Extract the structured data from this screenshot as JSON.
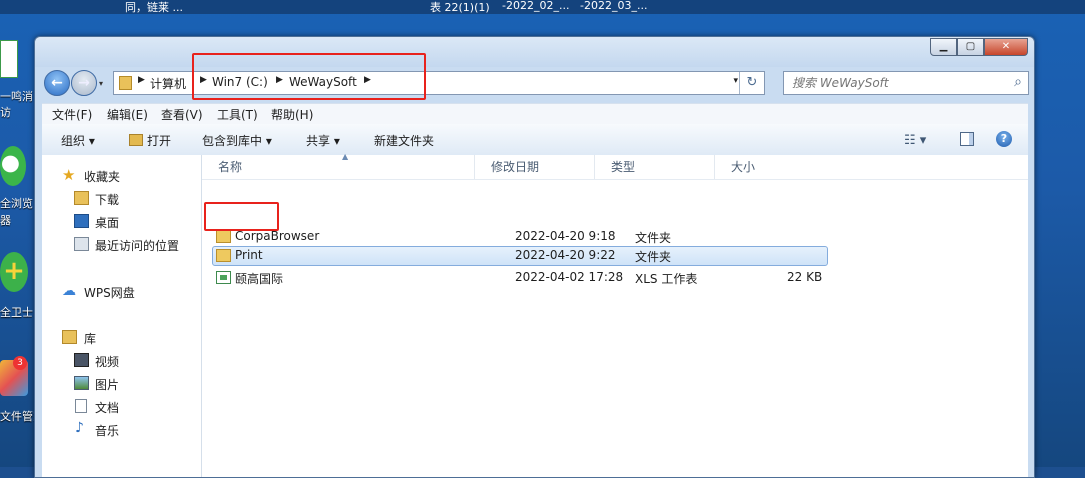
{
  "taskbar_top": {
    "items": [
      "同，链莱 ...",
      "表 22(1)(1)",
      "-2022_02_...",
      "-2022_03_..."
    ]
  },
  "desktop": {
    "labels": [
      "一鸣消",
      "访",
      "全浏览",
      "器",
      "全卫士",
      "文件管家"
    ],
    "badge": "3"
  },
  "window": {
    "controls": {
      "minimize": "▁",
      "maximize": "▢",
      "close": "✕"
    }
  },
  "address_bar": {
    "crumbs": [
      "计算机",
      "Win7 (C:)",
      "WeWaySoft"
    ],
    "dropdown": "▾",
    "refresh": "↻"
  },
  "search": {
    "placeholder": "搜索 WeWaySoft",
    "icon": "search-icon"
  },
  "menu": [
    "文件(F)",
    "编辑(E)",
    "查看(V)",
    "工具(T)",
    "帮助(H)"
  ],
  "toolbar": {
    "organize": "组织 ▾",
    "open": "打开",
    "include_library": "包含到库中 ▾",
    "share": "共享 ▾",
    "new_folder": "新建文件夹",
    "view": "☷ ▾",
    "help": "?"
  },
  "nav_pane": {
    "favorites": "收藏夹",
    "downloads": "下载",
    "desktop": "桌面",
    "recent": "最近访问的位置",
    "wps": "WPS网盘",
    "libraries": "库",
    "videos": "视频",
    "pictures": "图片",
    "documents": "文档",
    "music": "音乐"
  },
  "columns": {
    "name": "名称",
    "modified": "修改日期",
    "type": "类型",
    "size": "大小"
  },
  "files": [
    {
      "name": "CorpaBrowser",
      "modified": "2022-04-20 9:18",
      "type": "文件夹",
      "size": "",
      "kind": "folder",
      "selected": false
    },
    {
      "name": "Print",
      "modified": "2022-04-20 9:22",
      "type": "文件夹",
      "size": "",
      "kind": "folder",
      "selected": true
    },
    {
      "name": "颐高国际",
      "modified": "2022-04-02 17:28",
      "type": "XLS 工作表",
      "size": "22 KB",
      "kind": "xls",
      "selected": false
    }
  ],
  "colors": {
    "highlight": "#e8221c",
    "selection": "#cfe3f8",
    "folder": "#eec95f"
  }
}
